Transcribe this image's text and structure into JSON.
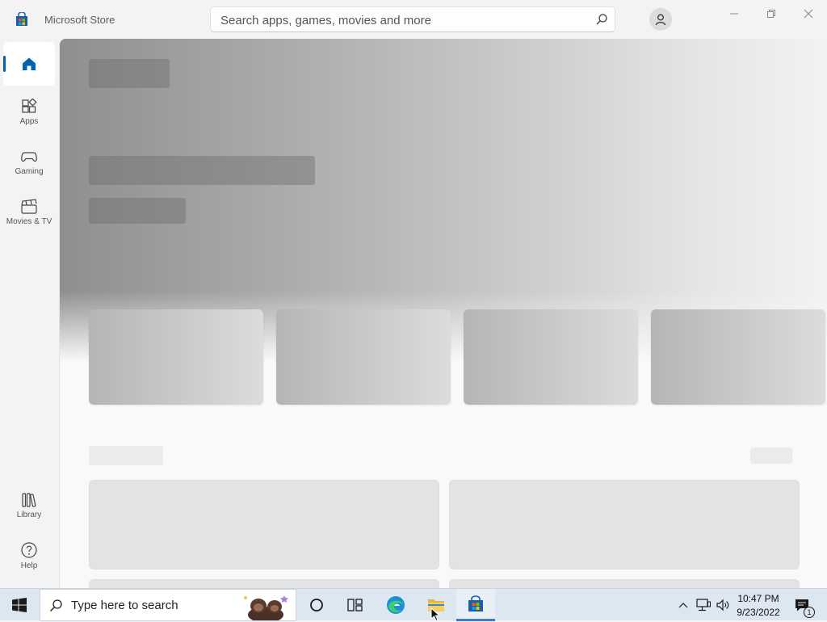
{
  "window": {
    "title": "Microsoft Store",
    "search_placeholder": "Search apps, games, movies and more",
    "controls": [
      "minimize-icon",
      "restore-icon",
      "close-icon"
    ]
  },
  "nav": {
    "items": [
      {
        "id": "home",
        "label": "",
        "icon": "home-icon",
        "selected": true
      },
      {
        "id": "apps",
        "label": "Apps",
        "icon": "apps-icon"
      },
      {
        "id": "gaming",
        "label": "Gaming",
        "icon": "gamepad-icon"
      },
      {
        "id": "movies",
        "label": "Movies & TV",
        "icon": "clapperboard-icon"
      }
    ],
    "bottom_items": [
      {
        "id": "library",
        "label": "Library",
        "icon": "library-icon"
      },
      {
        "id": "help",
        "label": "Help",
        "icon": "help-icon"
      }
    ]
  },
  "content": {
    "state": "loading placeholders"
  },
  "taskbar": {
    "search_placeholder": "Type here to search",
    "time": "10:47 PM",
    "date": "9/23/2022",
    "notification_count": "1",
    "accent": "#0063b1"
  }
}
